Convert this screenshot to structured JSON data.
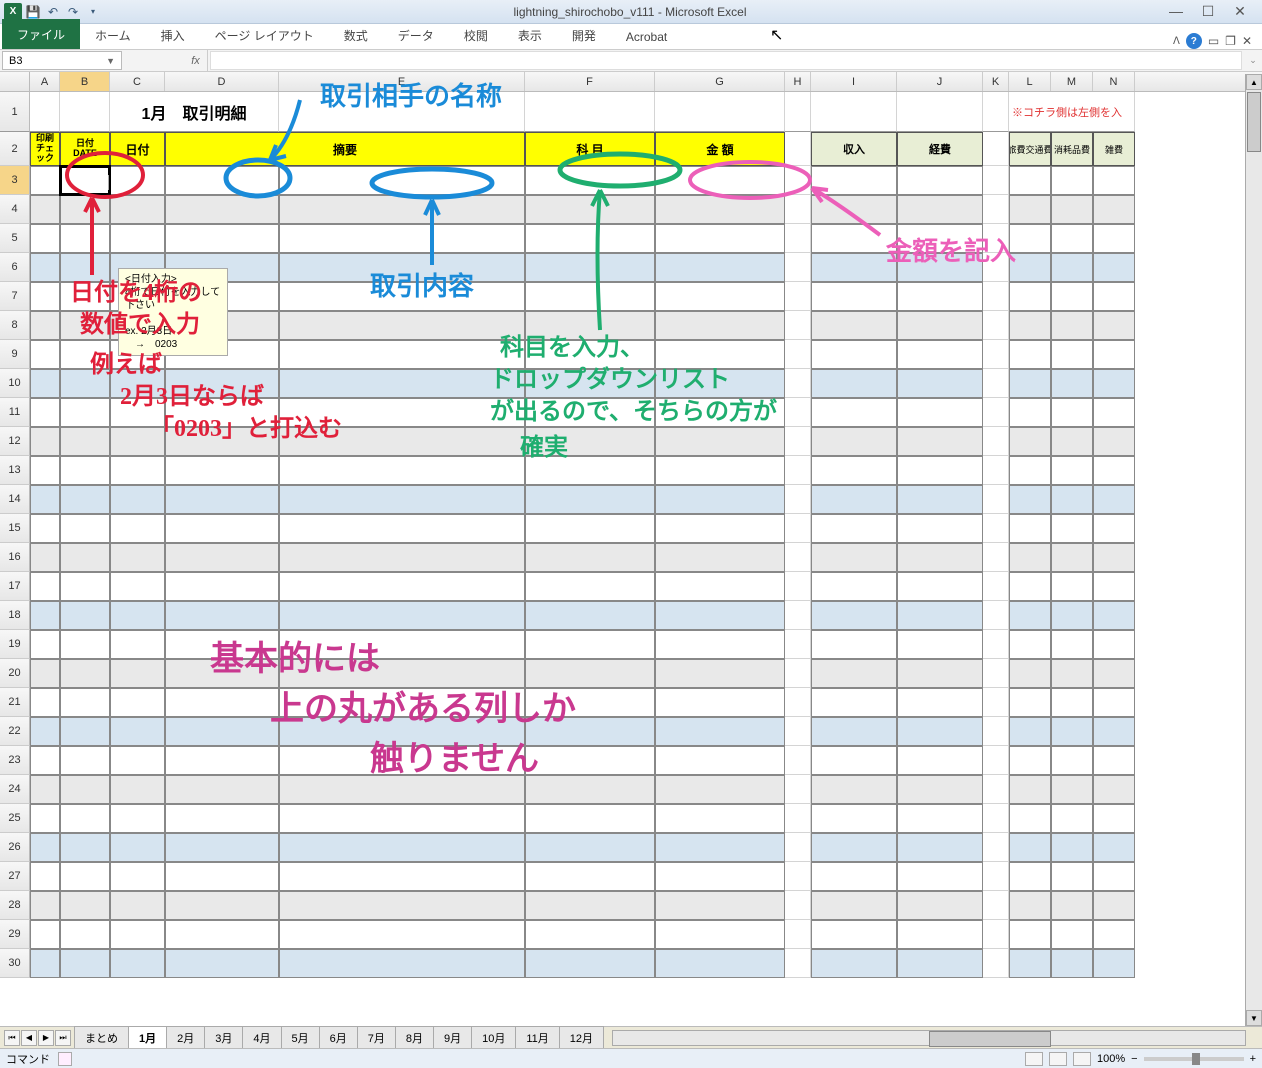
{
  "app": {
    "title": "lightning_shirochobo_v111 - Microsoft Excel",
    "name_box": "B3"
  },
  "ribbon": {
    "file": "ファイル",
    "tabs": [
      "ホーム",
      "挿入",
      "ページ レイアウト",
      "数式",
      "データ",
      "校閲",
      "表示",
      "開発",
      "Acrobat"
    ]
  },
  "columns": [
    "A",
    "B",
    "C",
    "D",
    "E",
    "F",
    "G",
    "H",
    "I",
    "J",
    "K",
    "L",
    "M",
    "N"
  ],
  "sheet": {
    "title": "1月　取引明細",
    "note": "※コチラ側は左側を入",
    "headers": {
      "check": "印刷\nチェック",
      "date_inp": "日付\nDATE",
      "date": "日付",
      "summary": "摘要",
      "subject": "科 目",
      "amount": "金 額",
      "income": "収入",
      "expense": "経費",
      "travel": "旅費交通費",
      "supplies": "消耗品費",
      "misc": "雑費"
    }
  },
  "tooltip": {
    "title": "<日付入力>",
    "line1": "4桁で日付を入力して下さい",
    "line2": "ex. 2月3日",
    "line3": "　→　0203"
  },
  "tabs": [
    "まとめ",
    "1月",
    "2月",
    "3月",
    "4月",
    "5月",
    "6月",
    "7月",
    "8月",
    "9月",
    "10月",
    "11月",
    "12月"
  ],
  "status": {
    "left": "コマンド",
    "zoom": "100%"
  },
  "annotations": {
    "a1": "取引相手の名称",
    "a2": "取引内容",
    "a3": "日付を4桁の\n数値で入力\n例えば\n2月3日ならば\n「0203」と打込む",
    "a4": "科目を入力、\nドロップダウンリスト\nが出るので、そちらの方が\n確実",
    "a5": "金額を記入",
    "a6": "基本的には\n上の丸がある列しか\n触りません"
  }
}
